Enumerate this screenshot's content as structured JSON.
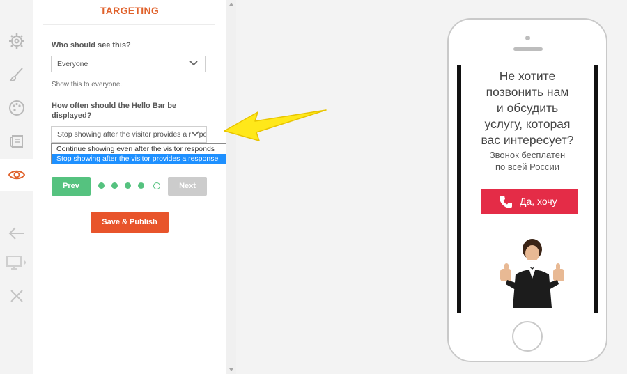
{
  "panel": {
    "title": "TARGETING",
    "who_label": "Who should see this?",
    "who_value": "Everyone",
    "who_help": "Show this to everyone.",
    "often_label_line1": "How often should the Hello Bar be",
    "often_label_line2": "displayed?",
    "often_value": "Stop showing after the visitor provides a response",
    "options": [
      "Continue showing even after the visitor responds",
      "Stop showing after the visitor provides a response"
    ],
    "prev_label": "Prev",
    "next_label": "Next",
    "publish_label": "Save & Publish",
    "progress": {
      "filled_steps": 4,
      "total_steps": 5
    }
  },
  "rail": {
    "items": [
      "gear-icon",
      "brush-icon",
      "palette-icon",
      "content-icon",
      "eye-icon"
    ],
    "active": "eye-icon",
    "bottom": [
      "back-arrow-icon",
      "desktop-icon",
      "close-icon"
    ]
  },
  "preview": {
    "headline_lines": [
      "Не хотите",
      "позвонить нам",
      "и обсудить",
      "услугу, которая",
      "вас интересует?"
    ],
    "sub_lines": [
      "Звонок бесплатен",
      "по всей России"
    ],
    "cta_label": "Да, хочу"
  },
  "colors": {
    "accent_orange": "#e0622c",
    "publish": "#e8542b",
    "green": "#55c27f",
    "cta_red": "#e42c47",
    "select_highlight": "#1e90ff",
    "arrow_yellow": "#ffe81a"
  }
}
